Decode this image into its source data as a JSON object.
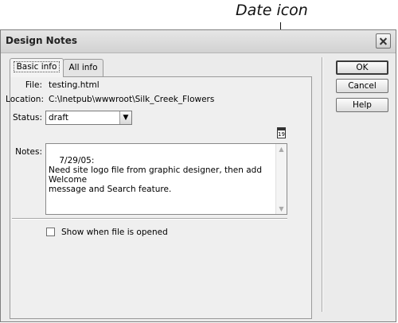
{
  "annotation": {
    "label": "Date icon"
  },
  "window": {
    "title": "Design Notes"
  },
  "tabs": [
    {
      "label": "Basic info",
      "active": true
    },
    {
      "label": "All info",
      "active": false
    }
  ],
  "fields": {
    "file_label": "File:",
    "file_value": "testing.html",
    "location_label": "Location:",
    "location_value": "C:\\Inetpub\\wwwroot\\Silk_Creek_Flowers",
    "status_label": "Status:",
    "status_value": "draft",
    "notes_label": "Notes:",
    "notes_value": "7/29/05:\nNeed site logo file from graphic designer, then add Welcome\nmessage and Search feature.",
    "date_icon_text": "19"
  },
  "checkbox": {
    "label": "Show when file is opened",
    "checked": false
  },
  "buttons": {
    "ok": "OK",
    "cancel": "Cancel",
    "help": "Help"
  }
}
